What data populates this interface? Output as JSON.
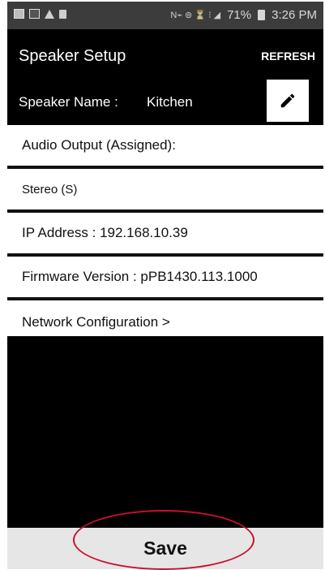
{
  "status_bar": {
    "left_icons": [
      "gallery-icon",
      "app-icon",
      "warning-icon",
      "trash-icon"
    ],
    "right_glyphs": "N⌁ ⊚ ⏳ ⁝ ◢",
    "battery": "71%",
    "time": "3:26 PM"
  },
  "header": {
    "title": "Speaker Setup",
    "refresh_label": "REFRESH",
    "speaker_name_label": "Speaker Name :",
    "speaker_name_value": "Kitchen",
    "edit_icon": "pencil-icon"
  },
  "list": {
    "audio_output_label": "Audio Output (Assigned):",
    "audio_output_value": "Stereo (S)",
    "ip_address": "IP  Address : 192.168.10.39",
    "firmware": "Firmware  Version : pPB1430.113.1000",
    "network": "Network  Configuration >"
  },
  "footer": {
    "save_label": "Save",
    "highlight_color": "#c8102e"
  }
}
